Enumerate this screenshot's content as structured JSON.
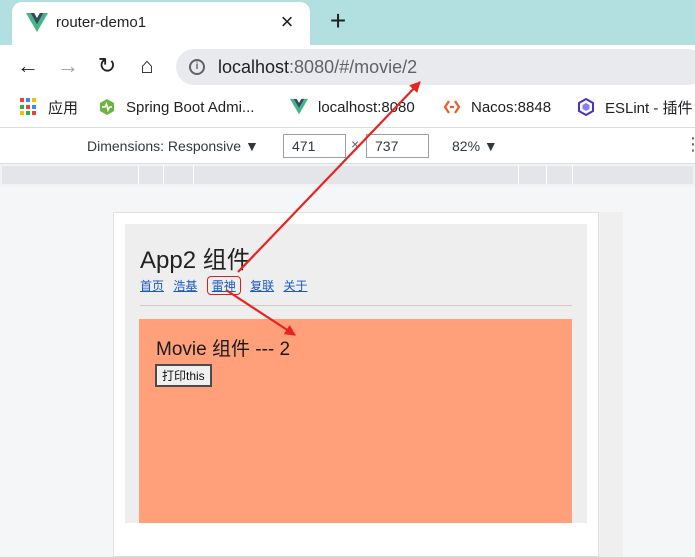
{
  "tab": {
    "title": "router-demo1",
    "close_icon": "×",
    "new_tab_icon": "+"
  },
  "toolbar": {
    "back_icon": "←",
    "forward_icon": "→",
    "reload_icon": "↻",
    "home_icon": "⌂",
    "info_icon": "i",
    "url_host": "localhost",
    "url_rest": ":8080/#/movie/2"
  },
  "bookmarks": [
    {
      "label": "应用",
      "icon": "apps-grid-icon"
    },
    {
      "label": "Spring Boot Admi...",
      "icon": "spring-boot-admin-icon"
    },
    {
      "label": "localhost:8080",
      "icon": "vue-logo-icon"
    },
    {
      "label": "Nacos:8848",
      "icon": "nacos-icon"
    },
    {
      "label": "ESLint - 插件",
      "icon": "eslint-icon"
    }
  ],
  "devtools": {
    "dimensions_label": "Dimensions: Responsive ▼",
    "width": "471",
    "times": "×",
    "height": "737",
    "zoom": "82% ▼",
    "more_icon": "⋮"
  },
  "page": {
    "app_title": "App2 组件",
    "links": [
      "首页",
      "浩基",
      "雷神",
      "复联",
      "关于"
    ],
    "active_link": "雷神",
    "movie_title": "Movie 组件 --- 2",
    "print_button": "打印this"
  },
  "colors": {
    "tab_strip": "#b2e0e0",
    "movie_bg": "#ffa07a",
    "app_bg": "#eeeeee",
    "link": "#1a57c4",
    "annotation_red": "#e8231f"
  }
}
